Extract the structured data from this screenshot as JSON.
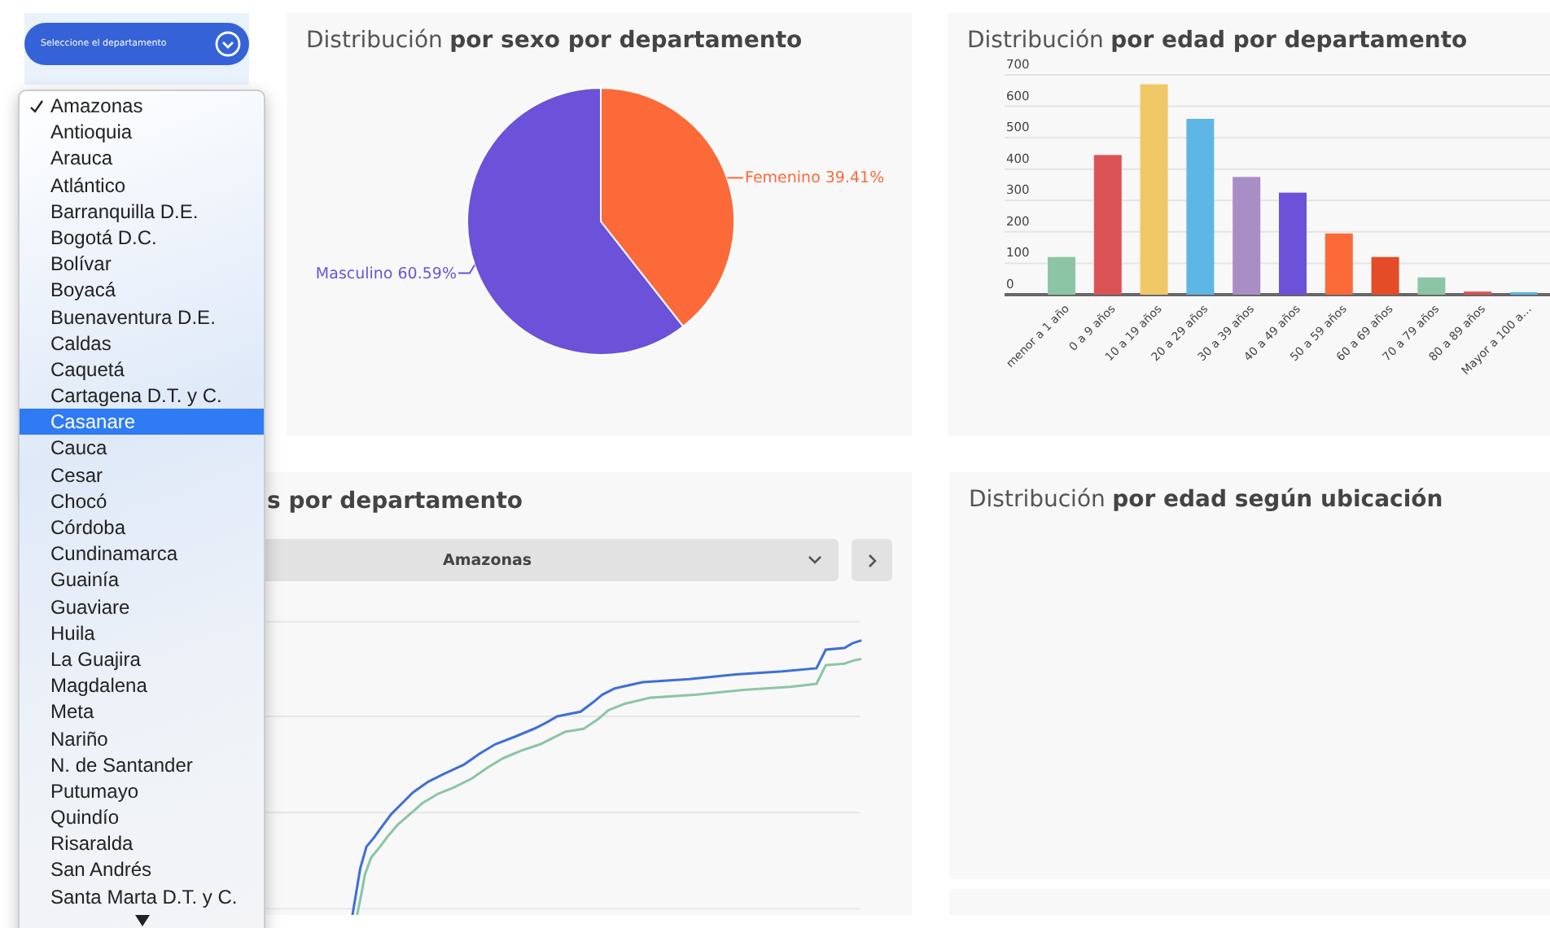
{
  "sidebar": {
    "department_button": {
      "label": "Seleccione el departamento"
    }
  },
  "department_menu": {
    "items": [
      {
        "label": "Amazonas",
        "checked": true,
        "selected": false
      },
      {
        "label": "Antioquia",
        "checked": false,
        "selected": false
      },
      {
        "label": "Arauca",
        "checked": false,
        "selected": false
      },
      {
        "label": "Atlántico",
        "checked": false,
        "selected": false
      },
      {
        "label": "Barranquilla D.E.",
        "checked": false,
        "selected": false
      },
      {
        "label": "Bogotá D.C.",
        "checked": false,
        "selected": false
      },
      {
        "label": "Bolívar",
        "checked": false,
        "selected": false
      },
      {
        "label": "Boyacá",
        "checked": false,
        "selected": false
      },
      {
        "label": "Buenaventura D.E.",
        "checked": false,
        "selected": false
      },
      {
        "label": "Caldas",
        "checked": false,
        "selected": false
      },
      {
        "label": "Caquetá",
        "checked": false,
        "selected": false
      },
      {
        "label": "Cartagena D.T. y C.",
        "checked": false,
        "selected": false
      },
      {
        "label": "Casanare",
        "checked": false,
        "selected": true
      },
      {
        "label": "Cauca",
        "checked": false,
        "selected": false
      },
      {
        "label": "Cesar",
        "checked": false,
        "selected": false
      },
      {
        "label": "Chocó",
        "checked": false,
        "selected": false
      },
      {
        "label": "Córdoba",
        "checked": false,
        "selected": false
      },
      {
        "label": "Cundinamarca",
        "checked": false,
        "selected": false
      },
      {
        "label": "Guainía",
        "checked": false,
        "selected": false
      },
      {
        "label": "Guaviare",
        "checked": false,
        "selected": false
      },
      {
        "label": "Huila",
        "checked": false,
        "selected": false
      },
      {
        "label": "La Guajira",
        "checked": false,
        "selected": false
      },
      {
        "label": "Magdalena",
        "checked": false,
        "selected": false
      },
      {
        "label": "Meta",
        "checked": false,
        "selected": false
      },
      {
        "label": "Nariño",
        "checked": false,
        "selected": false
      },
      {
        "label": "N. de Santander",
        "checked": false,
        "selected": false
      },
      {
        "label": "Putumayo",
        "checked": false,
        "selected": false
      },
      {
        "label": "Quindío",
        "checked": false,
        "selected": false
      },
      {
        "label": "Risaralda",
        "checked": false,
        "selected": false
      },
      {
        "label": "San Andrés",
        "checked": false,
        "selected": false
      },
      {
        "label": "Santa Marta D.T. y C.",
        "checked": false,
        "selected": false
      }
    ]
  },
  "sex_panel": {
    "title": {
      "lead": "Distribución",
      "emphasis": "por sexo por departamento"
    },
    "chart_data": {
      "type": "pie",
      "categories": [
        "Femenino",
        "Masculino"
      ],
      "values": [
        39.41,
        60.59
      ],
      "colors": [
        "#fc6a3a",
        "#6c52d9"
      ],
      "value_labels": [
        "39.41%",
        "60.59%"
      ]
    }
  },
  "age_panel": {
    "title": {
      "lead": "Distribución",
      "emphasis": "por edad por departamento"
    },
    "chart_data": {
      "type": "bar",
      "categories": [
        "menor a 1 año",
        "0 a 9 años",
        "10 a 19 años",
        "20 a 29 años",
        "30 a 39 años",
        "40 a 49 años",
        "50 a 59 años",
        "60 a 69 años",
        "70 a 79 años",
        "80 a 89 años",
        "Mayor a 100 a…"
      ],
      "values": [
        120,
        445,
        670,
        560,
        375,
        325,
        195,
        120,
        55,
        10,
        8
      ],
      "colors": [
        "#8cc5a6",
        "#dc5357",
        "#f0c866",
        "#5eb6e4",
        "#a98ec6",
        "#6c52d9",
        "#fc6a3a",
        "#e34c26",
        "#8cc5a6",
        "#dc5357",
        "#5eb6e4"
      ],
      "ylim": [
        0,
        700
      ],
      "grid": true,
      "yticks": [
        0,
        100,
        200,
        300,
        400,
        500,
        600,
        700
      ]
    }
  },
  "trend_panel": {
    "title": {
      "emphasis": "s por departamento"
    },
    "department_select": {
      "value": "Amazonas"
    }
  },
  "location_panel": {
    "title": {
      "lead": "Distribución",
      "emphasis": "por edad según ubicación"
    }
  }
}
